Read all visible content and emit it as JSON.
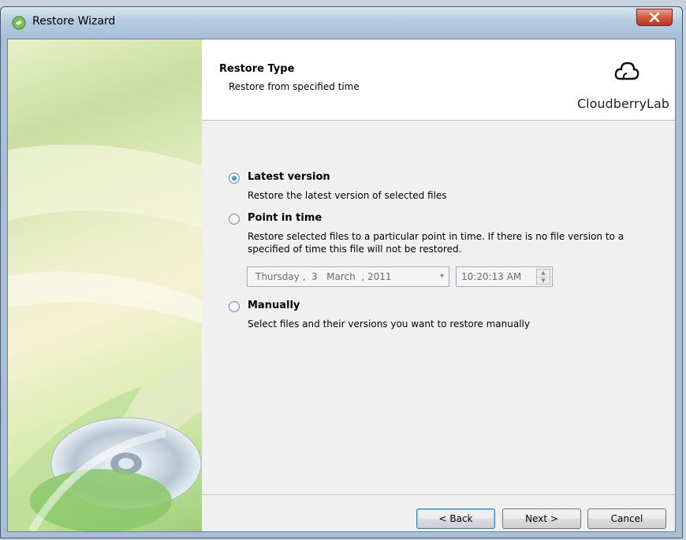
{
  "window": {
    "title": "Restore Wizard",
    "close_glyph": "x",
    "icon": "app-leaf-icon"
  },
  "header": {
    "title": "Restore Type",
    "subtitle": "Restore from specified time",
    "logo_text": "CloudberryLab",
    "logo_icon": "cloud-icon"
  },
  "options": [
    {
      "label": "Latest version",
      "description": "Restore the latest version of selected files",
      "selected": true
    },
    {
      "label": "Point in time",
      "description_line1": "Restore selected files to a particular point in time. If there is no file version to a",
      "description_line2": "specified of time this file will not be restored.",
      "selected": false
    },
    {
      "label": "Manually",
      "description": "Select files and their versions you want to restore manually",
      "selected": false
    }
  ],
  "point_in_time": {
    "date": "Thursday ,  3   March  , 2011",
    "date_arrow": "▾",
    "time": "10:20:13 AM",
    "spin_up": "▲",
    "spin_down": "▼"
  },
  "buttons": {
    "back": "< Back",
    "next": "Next >",
    "cancel": "Cancel"
  },
  "colors": {
    "accent": "#1c5ea8",
    "close": "#c8452b",
    "default_button_border": "#3c7fb1"
  }
}
